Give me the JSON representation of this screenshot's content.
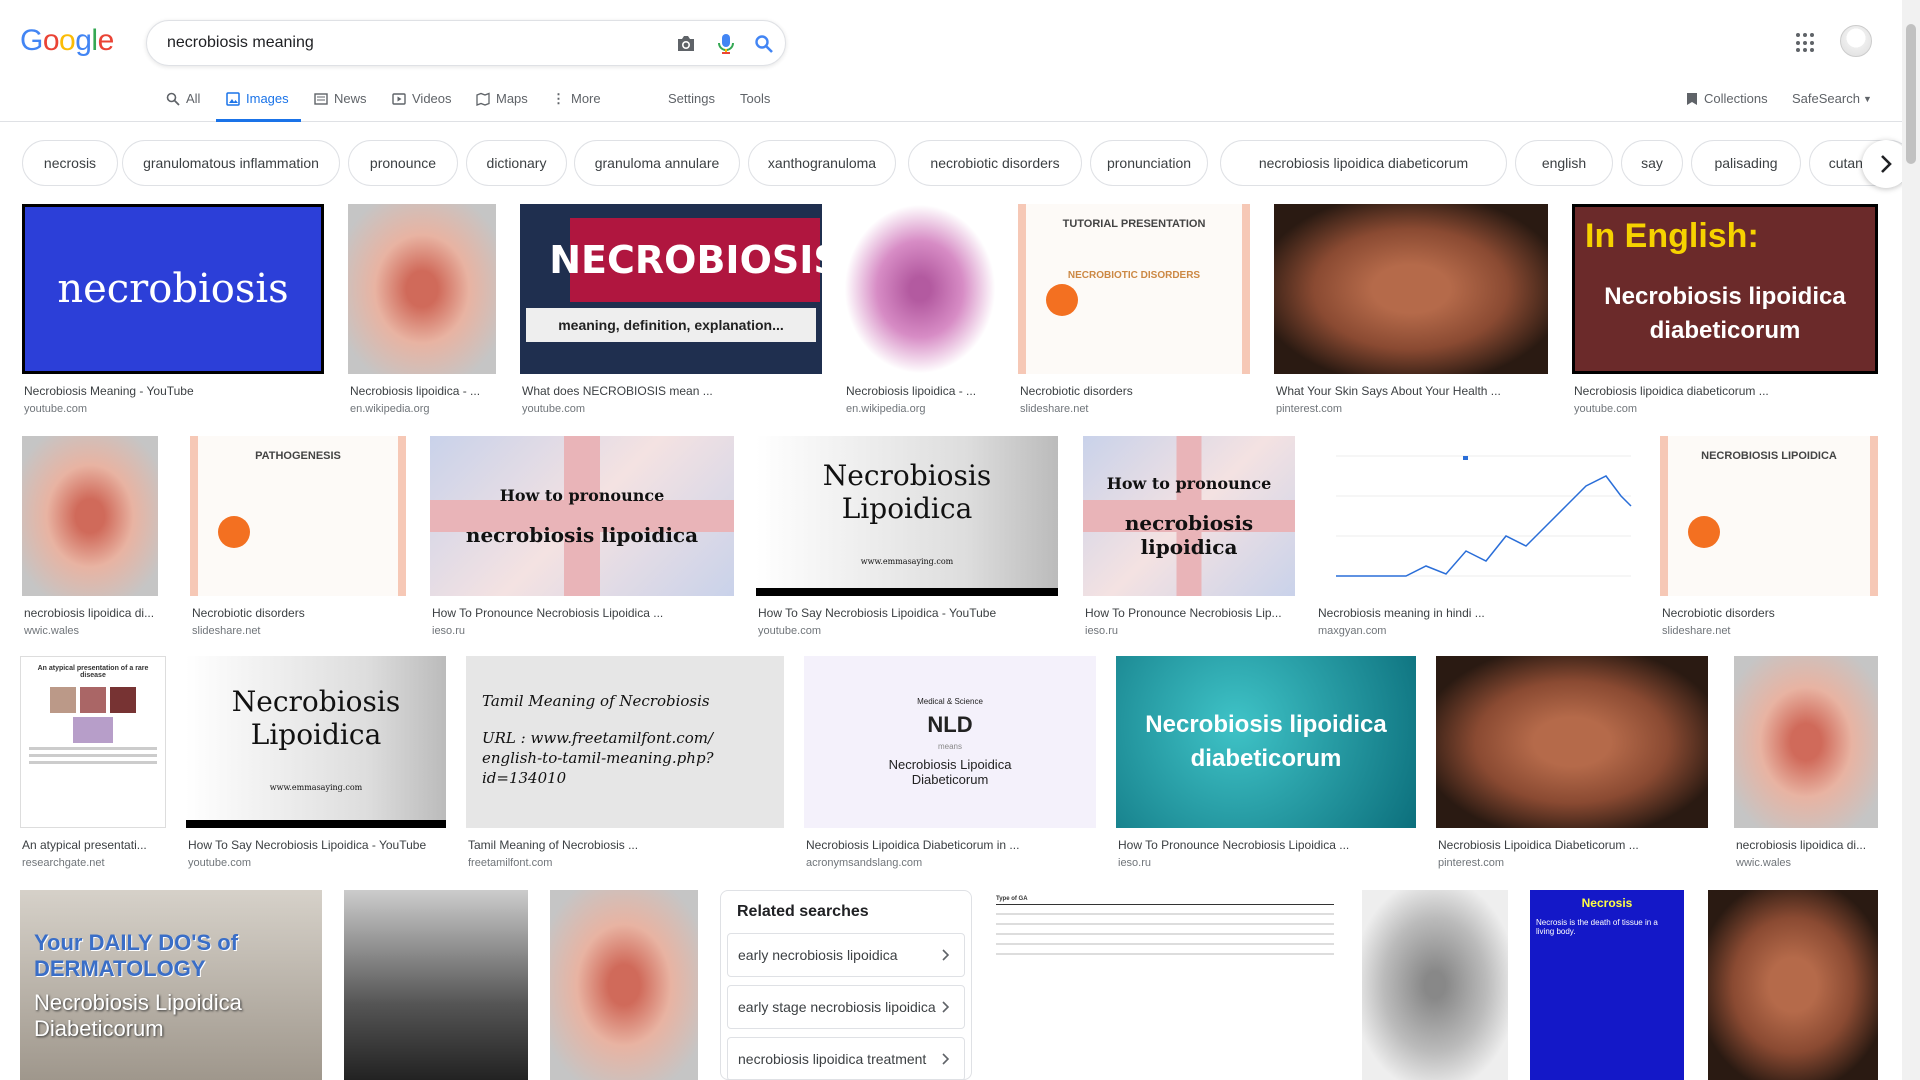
{
  "header": {
    "logo_letters": [
      {
        "char": "G",
        "color": "#4285f4"
      },
      {
        "char": "o",
        "color": "#ea4335"
      },
      {
        "char": "o",
        "color": "#fbbc05"
      },
      {
        "char": "g",
        "color": "#4285f4"
      },
      {
        "char": "l",
        "color": "#34a853"
      },
      {
        "char": "e",
        "color": "#ea4335"
      }
    ],
    "search_value": "necrobiosis meaning"
  },
  "tabs": {
    "all": "All",
    "images": "Images",
    "news": "News",
    "videos": "Videos",
    "maps": "Maps",
    "more": "More",
    "settings": "Settings",
    "tools": "Tools",
    "collections": "Collections",
    "safesearch": "SafeSearch"
  },
  "chips": [
    "necrosis",
    "granulomatous inflammation",
    "pronounce",
    "dictionary",
    "granuloma annulare",
    "xanthogranuloma",
    "necrobiotic disorders",
    "pronunciation",
    "necrobiosis lipoidica diabeticorum",
    "english",
    "say",
    "palisading",
    "cutaneous"
  ],
  "results": [
    {
      "caption": "Necrobiosis Meaning - YouTube",
      "source": "youtube.com",
      "thumb_text": "necrobiosis"
    },
    {
      "caption": "Necrobiosis lipoidica - ...",
      "source": "en.wikipedia.org",
      "thumb_text": ""
    },
    {
      "caption": "What does NECROBIOSIS mean ...",
      "source": "youtube.com",
      "thumb_text": "NECROBIOSIS",
      "thumb_sub": "meaning, definition, explanation..."
    },
    {
      "caption": "Necrobiosis lipoidica - ...",
      "source": "en.wikipedia.org",
      "thumb_text": ""
    },
    {
      "caption": "Necrobiotic disorders",
      "source": "slideshare.net",
      "thumb_text": "TUTORIAL PRESENTATION",
      "thumb_sub": "NECROBIOTIC DISORDERS"
    },
    {
      "caption": "What Your Skin Says About Your Health ...",
      "source": "pinterest.com",
      "thumb_text": ""
    },
    {
      "caption": "Necrobiosis lipoidica diabeticorum ...",
      "source": "youtube.com",
      "thumb_text": "In English:",
      "thumb_sub": "Necrobiosis lipoidica diabeticorum"
    },
    {
      "caption": "necrobiosis lipoidica di...",
      "source": "wwic.wales",
      "thumb_text": ""
    },
    {
      "caption": "Necrobiotic disorders",
      "source": "slideshare.net",
      "thumb_text": "PATHOGENESIS"
    },
    {
      "caption": "How To Pronounce Necrobiosis Lipoidica ...",
      "source": "ieso.ru",
      "thumb_text": "How to pronounce",
      "thumb_sub": "necrobiosis lipoidica"
    },
    {
      "caption": "How To Say Necrobiosis Lipoidica - YouTube",
      "source": "youtube.com",
      "thumb_text": "Necrobiosis Lipoidica",
      "thumb_sub": "www.emmasaying.com"
    },
    {
      "caption": "How To Pronounce Necrobiosis Lip...",
      "source": "ieso.ru",
      "thumb_text": "How to pronounce",
      "thumb_sub": "necrobiosis lipoidica"
    },
    {
      "caption": "Necrobiosis meaning in hindi ...",
      "source": "maxgyan.com",
      "thumb_text": ""
    },
    {
      "caption": "Necrobiotic disorders",
      "source": "slideshare.net",
      "thumb_text": "NECROBIOSIS LIPOIDICA"
    },
    {
      "caption": "An atypical presentati...",
      "source": "researchgate.net",
      "thumb_text": "An atypical presentation of a rare disease"
    },
    {
      "caption": "How To Say Necrobiosis Lipoidica - YouTube",
      "source": "youtube.com",
      "thumb_text": "Necrobiosis Lipoidica",
      "thumb_sub": "www.emmasaying.com"
    },
    {
      "caption": "Tamil Meaning of Necrobiosis ...",
      "source": "freetamilfont.com",
      "thumb_text": "Tamil Meaning of Necrobiosis",
      "thumb_sub": "URL : www.freetamilfont.com/ english-to-tamil-meaning.php?id=134010"
    },
    {
      "caption": "Necrobiosis Lipoidica Diabeticorum in ...",
      "source": "acronymsandslang.com",
      "thumb_text": "NLD",
      "thumb_sub": "Necrobiosis Lipoidica Diabeticorum",
      "thumb_top": "Medical & Science",
      "thumb_mid": "means"
    },
    {
      "caption": "How To Pronounce Necrobiosis Lipoidica ...",
      "source": "ieso.ru",
      "thumb_text": "Necrobiosis lipoidica",
      "thumb_sub": "diabeticorum"
    },
    {
      "caption": "Necrobiosis Lipoidica Diabeticorum ...",
      "source": "pinterest.com",
      "thumb_text": ""
    },
    {
      "caption": "necrobiosis lipoidica di...",
      "source": "wwic.wales",
      "thumb_text": ""
    },
    {
      "thumb_text": "Your DAILY DO'S of DERMATOLOGY",
      "thumb_sub": "Necrobiosis Lipoidica Diabeticorum"
    },
    {
      "thumb_text": ""
    },
    {
      "thumb_text": ""
    },
    {
      "thumb_text": "Type of GA"
    },
    {
      "thumb_text": ""
    },
    {
      "thumb_text": "Necrosis",
      "thumb_sub": "Necrosis is the death of tissue in a living body."
    },
    {
      "thumb_text": ""
    }
  ],
  "related": {
    "title": "Related searches",
    "items": [
      "early necrobiosis lipoidica",
      "early stage necrobiosis lipoidica",
      "necrobiosis lipoidica treatment"
    ]
  }
}
